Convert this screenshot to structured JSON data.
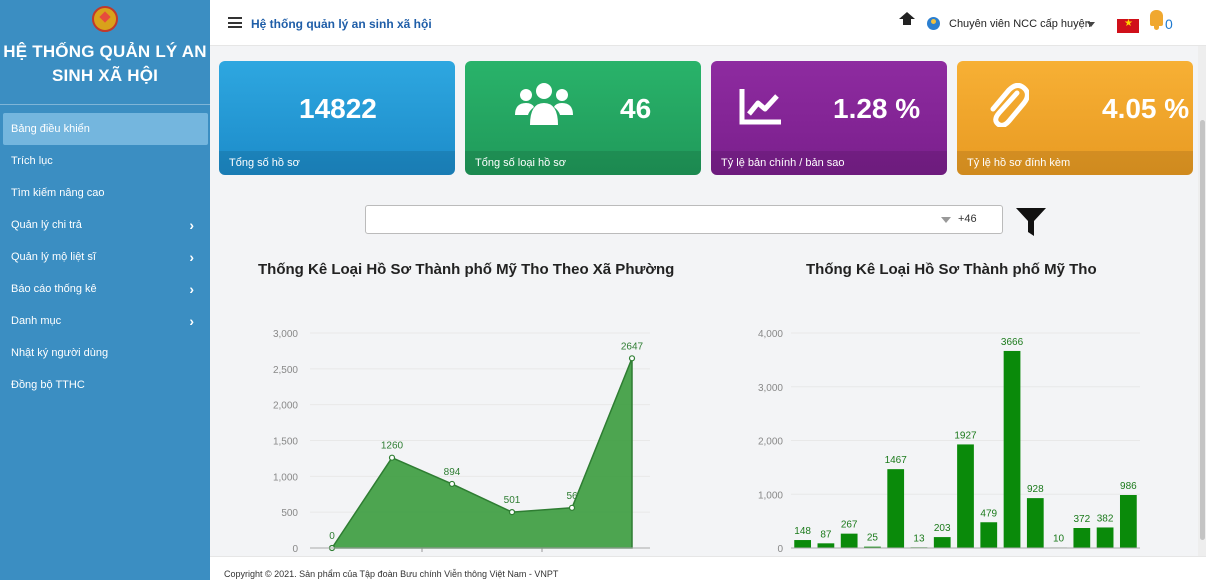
{
  "sidebar": {
    "title": "HỆ THỐNG QUẢN LÝ AN SINH XÃ HỘI",
    "items": [
      {
        "label": "Bảng điều khiển",
        "active": true
      },
      {
        "label": "Trích lục"
      },
      {
        "label": "Tìm kiếm nâng cao"
      },
      {
        "label": "Quản lý chi trả",
        "chevron": "›"
      },
      {
        "label": "Quản lý mộ liệt sĩ",
        "chevron": "›"
      },
      {
        "label": "Báo cáo thống kê",
        "chevron": "›"
      },
      {
        "label": "Danh mục",
        "chevron": "›"
      },
      {
        "label": "Nhật ký người dùng"
      },
      {
        "label": "Đồng bộ TTHC"
      }
    ]
  },
  "topbar": {
    "title": "Hệ thống quản lý an sinh xã hội",
    "user": "Chuyên viên NCC cấp huyện",
    "notifications": "0"
  },
  "cards": [
    {
      "value": "14822",
      "label": "Tổng số hồ sơ",
      "color": "#2ea7e0"
    },
    {
      "value": "46",
      "label": "Tổng số loại hồ sơ",
      "icon": "users-icon",
      "color": "#29b36a"
    },
    {
      "value": "1.28 %",
      "label": "Tỷ lệ bản chính / bản sao",
      "icon": "chart-line-icon",
      "color": "#8e2ba0"
    },
    {
      "value": "4.05 %",
      "label": "Tỷ lệ hồ sơ đính kèm",
      "icon": "paperclip-icon",
      "color": "#f7b035"
    }
  ],
  "filter": {
    "more": "+46"
  },
  "chart_data": [
    {
      "type": "area",
      "title": "Thống Kê Loại Hồ Sơ Thành phố Mỹ Tho Theo Xã Phường",
      "values": [
        0,
        1260,
        894,
        501,
        561,
        2647
      ],
      "data_labels": [
        "0",
        "1260",
        "894",
        "501",
        "56",
        "2647"
      ],
      "ylim": [
        0,
        3000
      ],
      "yticks": [
        "0",
        "500",
        "1,000",
        "1,500",
        "2,000",
        "2,500",
        "3,000"
      ],
      "color": "#43a047"
    },
    {
      "type": "bar",
      "title": "Thống Kê Loại Hồ Sơ Thành phố Mỹ Tho",
      "values": [
        148,
        87,
        267,
        25,
        1467,
        13,
        203,
        1927,
        479,
        3666,
        928,
        10,
        372,
        382,
        986
      ],
      "ylim": [
        0,
        4000
      ],
      "yticks": [
        "0",
        "1,000",
        "2,000",
        "3,000",
        "4,000"
      ],
      "color": "#0a8a0a"
    }
  ],
  "footer": "Copyright © 2021. Sản phẩm của Tập đoàn Bưu chính Viễn thông Việt Nam - VNPT"
}
